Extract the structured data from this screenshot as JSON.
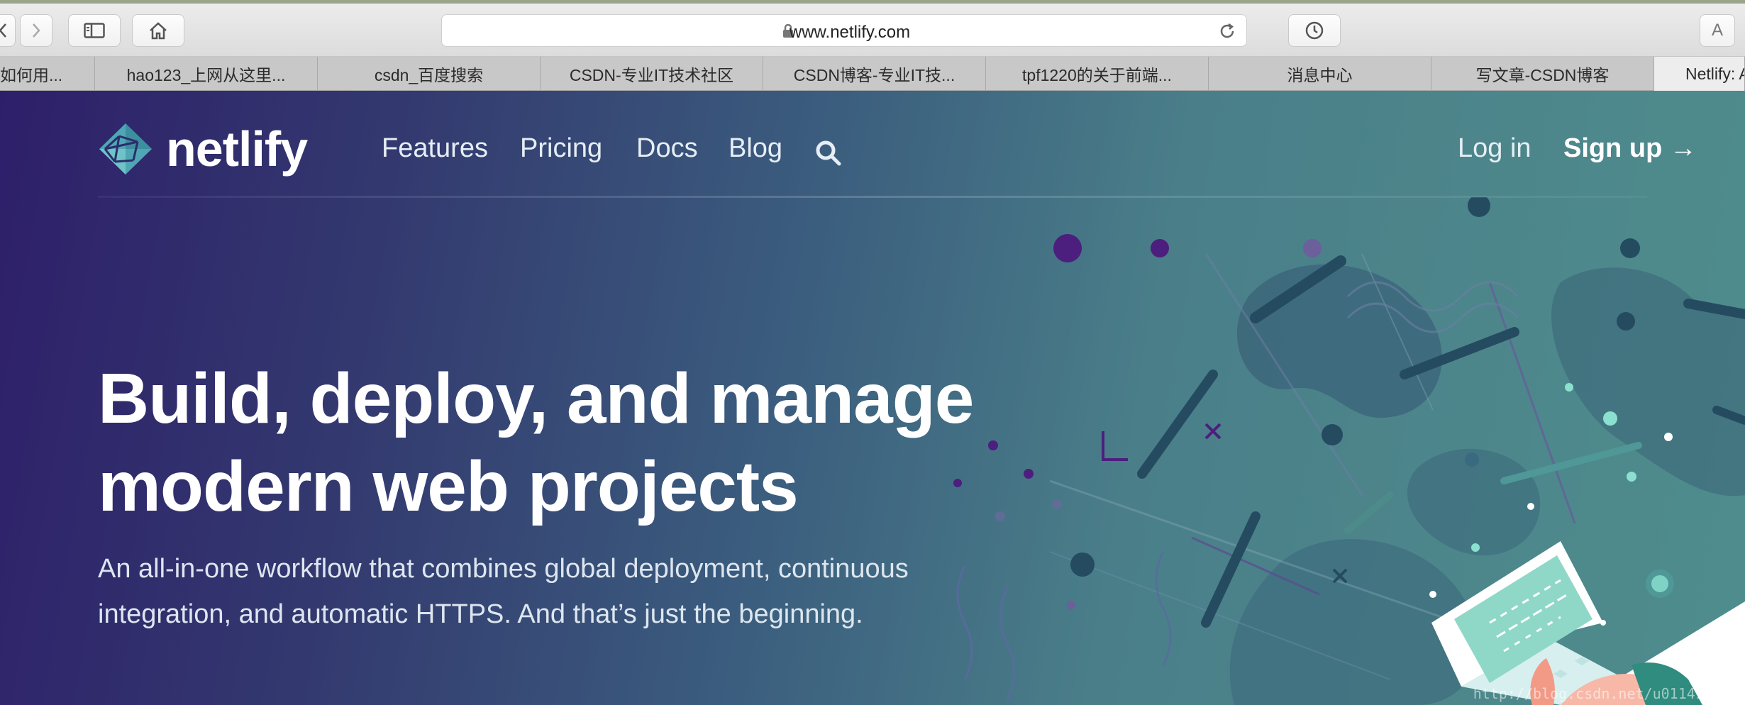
{
  "browser": {
    "url": "www.netlify.com",
    "reader_button_label": "A",
    "tabs": [
      {
        "label": "如何用..."
      },
      {
        "label": "hao123_上网从这里..."
      },
      {
        "label": "csdn_百度搜索"
      },
      {
        "label": "CSDN-专业IT技术社区"
      },
      {
        "label": "CSDN博客-专业IT技..."
      },
      {
        "label": "tpf1220的关于前端..."
      },
      {
        "label": "消息中心"
      },
      {
        "label": "写文章-CSDN博客"
      },
      {
        "label": "Netlify: A"
      }
    ]
  },
  "nav": {
    "logo_text": "netlify",
    "links": [
      "Features",
      "Pricing",
      "Docs",
      "Blog"
    ],
    "login": "Log in",
    "signup": "Sign up →"
  },
  "hero": {
    "title_line1": "Build, deploy, and manage",
    "title_line2": "modern web projects",
    "subtitle": "An all-in-one workflow that combines global deployment, continuous integration, and automatic HTTPS. And that’s just the beginning."
  },
  "watermark": "http://blog.csdn.net/u011415192"
}
